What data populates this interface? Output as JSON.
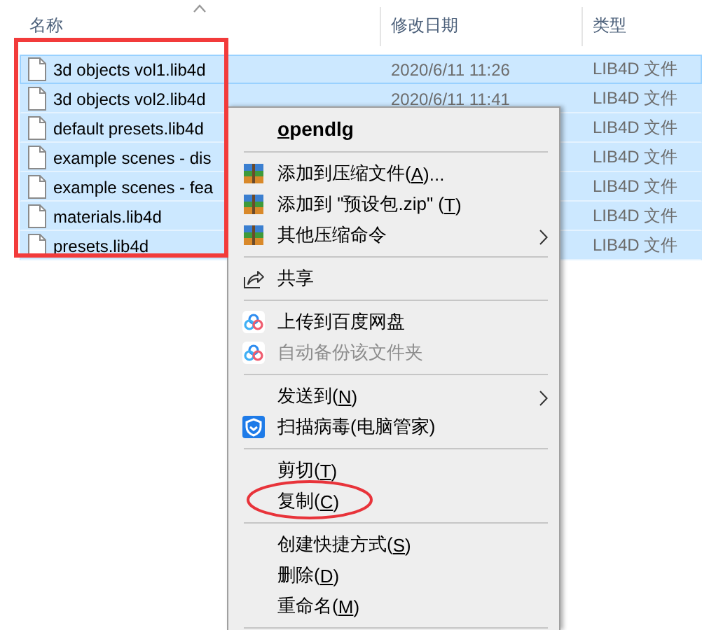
{
  "columns": [
    {
      "label": "名称",
      "sorted": true
    },
    {
      "label": "修改日期",
      "sorted": false
    },
    {
      "label": "类型",
      "sorted": false
    }
  ],
  "rows": [
    {
      "name": "3d objects vol1.lib4d",
      "date": "2020/6/11 11:26",
      "type": "LIB4D 文件",
      "selected": true,
      "focused": true
    },
    {
      "name": "3d objects vol2.lib4d",
      "date": "2020/6/11 11:41",
      "type": "LIB4D 文件",
      "selected": true,
      "focused": false
    },
    {
      "name": "default presets.lib4d",
      "type": "LIB4D 文件",
      "selected": true,
      "focused": false
    },
    {
      "name": "example scenes - dis",
      "type": "LIB4D 文件",
      "selected": true,
      "focused": false
    },
    {
      "name": "example scenes - fea",
      "type": "LIB4D 文件",
      "selected": true,
      "focused": false
    },
    {
      "name": "materials.lib4d",
      "type": "LIB4D 文件",
      "selected": true,
      "focused": false
    },
    {
      "name": "presets.lib4d",
      "type": "LIB4D 文件",
      "selected": true,
      "focused": false
    }
  ],
  "context_menu": {
    "items": [
      {
        "kind": "item",
        "key": "o",
        "tail": "pendlg",
        "default": true,
        "disabled": false,
        "submenu": false
      },
      {
        "kind": "separator"
      },
      {
        "kind": "archive",
        "text": "添加到压缩文件(",
        "key": "A",
        "tail": ")...",
        "default": false,
        "disabled": false,
        "submenu": false
      },
      {
        "kind": "archive",
        "text": "添加到 \"预设包.zip\" (",
        "key": "T",
        "tail": ")",
        "default": false,
        "disabled": false,
        "submenu": false
      },
      {
        "kind": "archive",
        "text": "其他压缩命令",
        "default": false,
        "disabled": false,
        "submenu": true
      },
      {
        "kind": "separator"
      },
      {
        "kind": "share",
        "text": "共享",
        "default": false,
        "disabled": false,
        "submenu": false
      },
      {
        "kind": "separator"
      },
      {
        "kind": "cloud",
        "text": "上传到百度网盘",
        "default": false,
        "disabled": false,
        "submenu": false
      },
      {
        "kind": "cloud",
        "text": "自动备份该文件夹",
        "default": false,
        "disabled": true,
        "submenu": false
      },
      {
        "kind": "separator"
      },
      {
        "kind": "item",
        "text": "发送到(",
        "key": "N",
        "tail": ")",
        "default": false,
        "disabled": false,
        "submenu": true
      },
      {
        "kind": "shield",
        "text": "扫描病毒(电脑管家)",
        "default": false,
        "disabled": false,
        "submenu": false
      },
      {
        "kind": "separator"
      },
      {
        "kind": "item",
        "text": "剪切(",
        "key": "T",
        "tail": ")",
        "default": false,
        "disabled": false,
        "submenu": false
      },
      {
        "kind": "item",
        "text": "复制(",
        "key": "C",
        "tail": ")",
        "default": false,
        "disabled": false,
        "submenu": false
      },
      {
        "kind": "separator"
      },
      {
        "kind": "item",
        "text": "创建快捷方式(",
        "key": "S",
        "tail": ")",
        "default": false,
        "disabled": false,
        "submenu": false
      },
      {
        "kind": "item",
        "text": "删除(",
        "key": "D",
        "tail": ")",
        "default": false,
        "disabled": false,
        "submenu": false
      },
      {
        "kind": "item",
        "text": "重命名(",
        "key": "M",
        "tail": ")",
        "default": false,
        "disabled": false,
        "submenu": false
      },
      {
        "kind": "separator"
      }
    ]
  }
}
